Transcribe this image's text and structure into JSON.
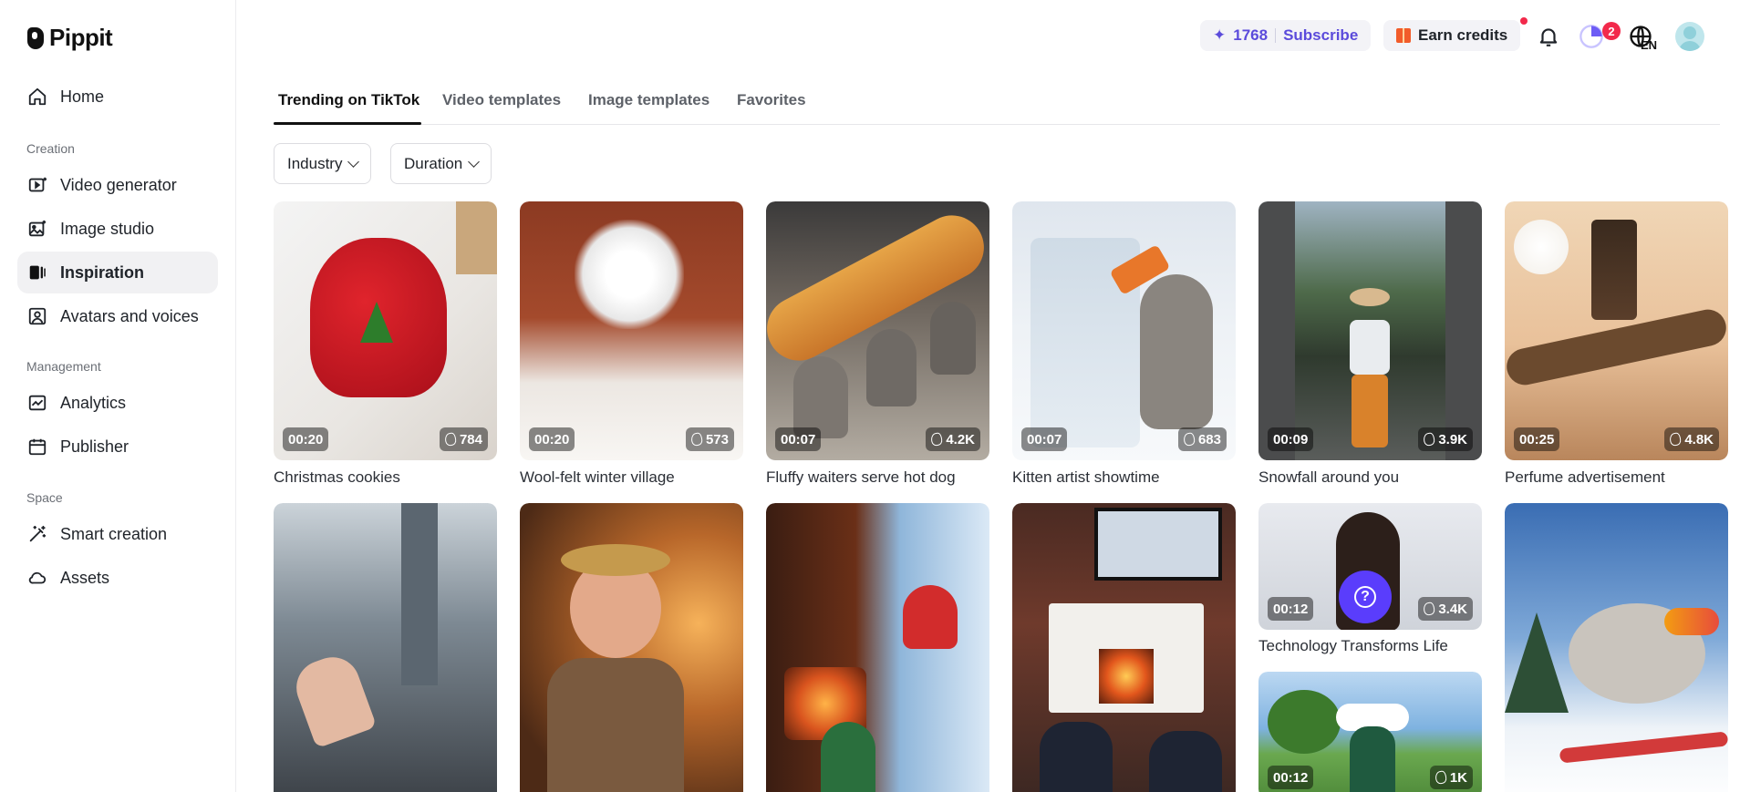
{
  "app": {
    "name": "Pippit"
  },
  "sidebar": {
    "items": [
      {
        "label": "Home",
        "icon": "home-icon"
      },
      {
        "section": "Creation"
      },
      {
        "label": "Video generator",
        "icon": "video-generator-icon"
      },
      {
        "label": "Image studio",
        "icon": "image-studio-icon"
      },
      {
        "label": "Inspiration",
        "icon": "inspiration-icon",
        "active": true
      },
      {
        "label": "Avatars and voices",
        "icon": "avatar-voice-icon"
      },
      {
        "section": "Management"
      },
      {
        "label": "Analytics",
        "icon": "analytics-icon"
      },
      {
        "label": "Publisher",
        "icon": "calendar-icon"
      },
      {
        "section": "Space"
      },
      {
        "label": "Smart creation",
        "icon": "magic-wand-icon"
      },
      {
        "label": "Assets",
        "icon": "cloud-icon"
      }
    ]
  },
  "topbar": {
    "credits": "1768",
    "subscribe_label": "Subscribe",
    "earn_label": "Earn credits",
    "notification_count": "2",
    "language": "EN",
    "accent_color": "#5b4bdb"
  },
  "tabs": [
    {
      "label": "Trending on TikTok",
      "active": true
    },
    {
      "label": "Video templates"
    },
    {
      "label": "Image templates"
    },
    {
      "label": "Favorites"
    }
  ],
  "filters": [
    {
      "label": "Industry"
    },
    {
      "label": "Duration"
    }
  ],
  "cards": [
    {
      "title": "Christmas cookies",
      "duration": "00:20",
      "views": "784"
    },
    {
      "title": "Wool-felt winter village",
      "duration": "00:20",
      "views": "573"
    },
    {
      "title": "Fluffy waiters serve hot dog",
      "duration": "00:07",
      "views": "4.2K"
    },
    {
      "title": "Kitten artist showtime",
      "duration": "00:07",
      "views": "683"
    },
    {
      "title": "Snowfall around you",
      "duration": "00:09",
      "views": "3.9K"
    },
    {
      "title": "Perfume advertisement",
      "duration": "00:25",
      "views": "4.8K"
    },
    {
      "title": "Technology Transforms Life",
      "duration": "00:12",
      "views": "3.4K"
    },
    {
      "title": "",
      "duration": "00:12",
      "views": "1K"
    }
  ]
}
